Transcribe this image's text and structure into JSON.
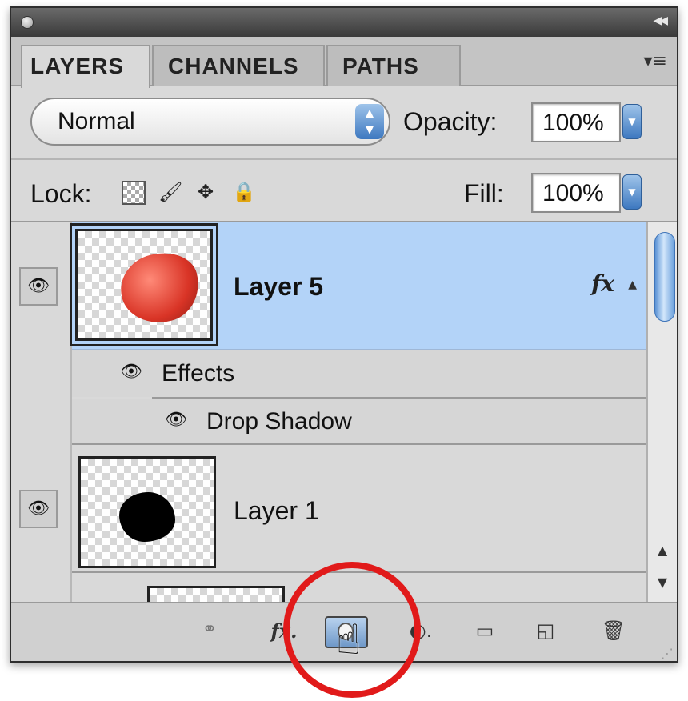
{
  "panel": {
    "collapse_icon": "double-chevron-right-icon",
    "menu_icon": "panel-menu-icon",
    "tabs": [
      {
        "label": "LAYERS",
        "active": true
      },
      {
        "label": "CHANNELS",
        "active": false
      },
      {
        "label": "PATHS",
        "active": false
      }
    ]
  },
  "blend": {
    "mode": "Normal",
    "opacity_label": "Opacity:",
    "opacity_value": "100%"
  },
  "lock": {
    "label": "Lock:",
    "icons": [
      "lock-transparent-pixels-icon",
      "lock-image-pixels-icon",
      "lock-position-icon",
      "lock-all-icon"
    ],
    "fill_label": "Fill:",
    "fill_value": "100%"
  },
  "layers": [
    {
      "name": "Layer 5",
      "selected": true,
      "visible": true,
      "has_fx": true,
      "fx_label": "fx"
    },
    {
      "name": "Layer 1",
      "selected": false,
      "visible": true,
      "has_fx": false
    }
  ],
  "effects": {
    "label": "Effects",
    "items": [
      "Drop Shadow"
    ]
  },
  "bottombar": {
    "icons": [
      "link-layers-icon",
      "layer-style-icon",
      "add-layer-mask-icon",
      "adjustment-layer-icon",
      "new-group-icon",
      "new-layer-icon",
      "delete-layer-icon"
    ]
  },
  "colors": {
    "selected_row": "#b3d3f8",
    "panel_bg": "#d9d9d9",
    "highlight_circle": "#e11a1a"
  }
}
